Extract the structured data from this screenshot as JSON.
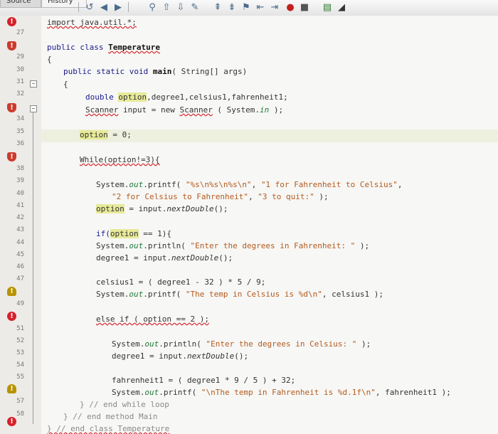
{
  "tabs": {
    "source": "Source",
    "history": "History"
  },
  "toolbar_icons": [
    "history-icon",
    "back-icon",
    "forward-icon",
    "find-icon",
    "find-prev-icon",
    "find-next-icon",
    "toggle-highlight-icon",
    "prev-bookmark-icon",
    "next-bookmark-icon",
    "toggle-bookmark-icon",
    "shift-left-icon",
    "shift-right-icon",
    "record-macro-icon",
    "stop-macro-icon",
    "comment-icon",
    "uncomment-icon"
  ],
  "line_numbers": [
    "27",
    "29",
    "30",
    "31",
    "32",
    "34",
    "35",
    "36",
    "38",
    "39",
    "40",
    "41",
    "42",
    "43",
    "44",
    "45",
    "46",
    "47",
    "49",
    "51",
    "52",
    "53",
    "54",
    "55",
    "57",
    "58"
  ],
  "code": {
    "import_stmt": "import java.util.*;",
    "class_kw": "public class ",
    "class_name": "Temperature",
    "brace_open": "{",
    "main_kw": "public static void ",
    "main_name": "main",
    "main_params": "( String[] args)",
    "double_kw": "double ",
    "var_option": "option",
    "double_rest": ",degree1,celsius1,fahrenheit1;",
    "scanner_type": "Scanner",
    "scanner_mid": " input = new ",
    "scanner_type2": "Scanner",
    "scanner_sys": " ( System.",
    "field_in": "in",
    "scanner_end": " );",
    "option_assign": " = 0;",
    "while_stmt": "While(option!=3){",
    "printf1_a": "System.",
    "field_out": "out",
    "printf_word": ".printf( ",
    "str_fmt": "\"%s\\n%s\\n%s\\n\"",
    "comma": ", ",
    "str_fahr": "\"1 for Fahrenheit to Celsius\"",
    "comma_end": ",",
    "str_cels": "\"2 for Celsius to Fahrenheit\"",
    "str_quit": "\"3 to quit:\"",
    "printf1_end": " );",
    "input_assign": " = input.",
    "next_double": "nextDouble",
    "call_end": "();",
    "if_kw": "if(",
    "if_rest": " == 1){",
    "println_word": ".println( ",
    "str_enter_f": "\"Enter the degrees in Fahrenheit: \"",
    "degree1": "degree1",
    "celsius_calc": "celsius1 = ( degree1 - 32 ) * 5 / 9;",
    "str_temp_c": "\"The temp in Celsius is %d\\n\"",
    "celsius_arg": ", celsius1 );",
    "else_if": "else if ( option == 2 );",
    "str_enter_c": "\"Enter the degrees in Celsius: \"",
    "fahr_calc": "fahrenheit1 = ( degree1 * 9 / 5 ) + 32;",
    "str_temp_f": "\"\\nThe temp in Fahrenheit is %d.1f\\n\"",
    "fahr_arg": ", fahrenheit1 );",
    "end_while": "} // end while loop",
    "end_main": "} // end method Main",
    "end_class": "} // end class Temperature"
  }
}
